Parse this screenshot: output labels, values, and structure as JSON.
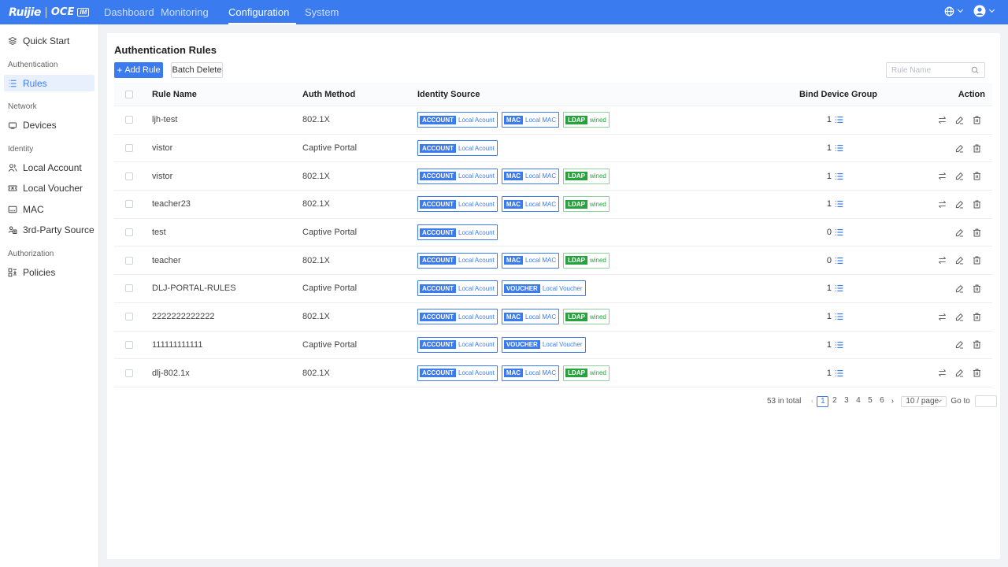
{
  "app": {
    "brand": "Ruijie",
    "product": "OCE",
    "badge": "IM"
  },
  "topnav": {
    "items": [
      {
        "label": "Dashboard"
      },
      {
        "label": "Monitoring"
      },
      {
        "label": "Configuration",
        "active": true
      },
      {
        "label": "System"
      }
    ],
    "right": {
      "language_icon": "globe-icon",
      "user_icon": "user-avatar-icon"
    }
  },
  "sidebar": {
    "quick_start": "Quick Start",
    "groups": {
      "authentication": "Authentication",
      "network": "Network",
      "identity": "Identity",
      "authorization": "Authorization"
    },
    "items": {
      "rules": "Rules",
      "devices": "Devices",
      "local_account": "Local Account",
      "local_voucher": "Local Voucher",
      "mac": "MAC",
      "third_party": "3rd-Party Source",
      "policies": "Policies"
    }
  },
  "main": {
    "title": "Authentication Rules",
    "add_button": "Add Rule",
    "batch_delete": "Batch Delete",
    "search_placeholder": "Rule Name",
    "columns": {
      "rule_name": "Rule Name",
      "auth_method": "Auth Method",
      "identity_source": "Identity Source",
      "bind_device_group": "Bind Device Group",
      "action": "Action"
    },
    "rows": [
      {
        "name": "ljh-test",
        "auth": "802.1X",
        "sources": [
          {
            "k": "ACCOUNT",
            "v": "Local Acount"
          },
          {
            "k": "MAC",
            "v": "Local MAC"
          },
          {
            "k": "LDAP",
            "v": "wined",
            "color": "green"
          }
        ],
        "bind": "1",
        "transfer": true
      },
      {
        "name": "vistor",
        "auth": "Captive Portal",
        "sources": [
          {
            "k": "ACCOUNT",
            "v": "Local Acount"
          }
        ],
        "bind": "1",
        "transfer": false
      },
      {
        "name": "vistor",
        "auth": "802.1X",
        "sources": [
          {
            "k": "ACCOUNT",
            "v": "Local Acount"
          },
          {
            "k": "MAC",
            "v": "Local MAC"
          },
          {
            "k": "LDAP",
            "v": "wined",
            "color": "green"
          }
        ],
        "bind": "1",
        "transfer": true
      },
      {
        "name": "teacher23",
        "auth": "802.1X",
        "sources": [
          {
            "k": "ACCOUNT",
            "v": "Local Acount"
          },
          {
            "k": "MAC",
            "v": "Local MAC"
          },
          {
            "k": "LDAP",
            "v": "wined",
            "color": "green"
          }
        ],
        "bind": "1",
        "transfer": true
      },
      {
        "name": "test",
        "auth": "Captive Portal",
        "sources": [
          {
            "k": "ACCOUNT",
            "v": "Local Acount"
          }
        ],
        "bind": "0",
        "transfer": false
      },
      {
        "name": "teacher",
        "auth": "802.1X",
        "sources": [
          {
            "k": "ACCOUNT",
            "v": "Local Acount"
          },
          {
            "k": "MAC",
            "v": "Local MAC"
          },
          {
            "k": "LDAP",
            "v": "wined",
            "color": "green"
          }
        ],
        "bind": "0",
        "transfer": true
      },
      {
        "name": "DLJ-PORTAL-RULES",
        "auth": "Captive Portal",
        "sources": [
          {
            "k": "ACCOUNT",
            "v": "Local Acount"
          },
          {
            "k": "VOUCHER",
            "v": "Local Voucher"
          }
        ],
        "bind": "1",
        "transfer": false
      },
      {
        "name": "2222222222222",
        "auth": "802.1X",
        "sources": [
          {
            "k": "ACCOUNT",
            "v": "Local Acount"
          },
          {
            "k": "MAC",
            "v": "Local MAC"
          },
          {
            "k": "LDAP",
            "v": "wined",
            "color": "green"
          }
        ],
        "bind": "1",
        "transfer": true
      },
      {
        "name": "111111111111",
        "auth": "Captive Portal",
        "sources": [
          {
            "k": "ACCOUNT",
            "v": "Local Acount"
          },
          {
            "k": "VOUCHER",
            "v": "Local Voucher"
          }
        ],
        "bind": "1",
        "transfer": false
      },
      {
        "name": "dlj-802.1x",
        "auth": "802.1X",
        "sources": [
          {
            "k": "ACCOUNT",
            "v": "Local Acount"
          },
          {
            "k": "MAC",
            "v": "Local MAC"
          },
          {
            "k": "LDAP",
            "v": "wined",
            "color": "green"
          }
        ],
        "bind": "1",
        "transfer": true
      }
    ],
    "pagination": {
      "total": "53 in total",
      "pages": [
        "1",
        "2",
        "3",
        "4",
        "5",
        "6"
      ],
      "current": "1",
      "page_size": "10 / page",
      "goto_label": "Go to",
      "goto_value": ""
    }
  },
  "colors": {
    "primary": "#3a7bf0",
    "ldap_green": "#26a33c",
    "sidebar_active_bg": "#e8f0fe"
  }
}
